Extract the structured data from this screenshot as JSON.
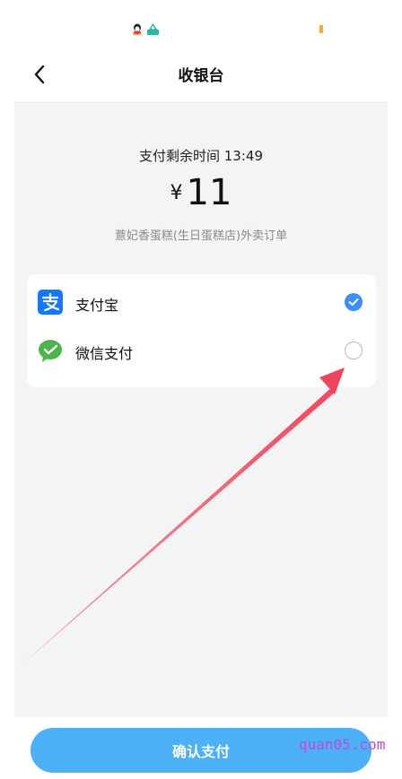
{
  "status_bar": {
    "battery_color": "#f0a93b"
  },
  "header": {
    "title": "收银台",
    "back_icon": "chevron-left-icon"
  },
  "payment": {
    "timer_text": "支付剩余时间 13:49",
    "currency": "¥",
    "amount": "11",
    "order_description": "薏妃香蛋糕(生日蛋糕店)外卖订单"
  },
  "methods": [
    {
      "label": "支付宝",
      "icon": "alipay-icon",
      "selected": true,
      "color": "#1677ff"
    },
    {
      "label": "微信支付",
      "icon": "wechat-pay-icon",
      "selected": false,
      "color": "#4bb54a"
    }
  ],
  "confirm": {
    "label": "确认支付",
    "color": "#4bb0f5"
  },
  "watermark": {
    "text": "quan05.com"
  },
  "annotation": {
    "color": "#f0435c"
  }
}
